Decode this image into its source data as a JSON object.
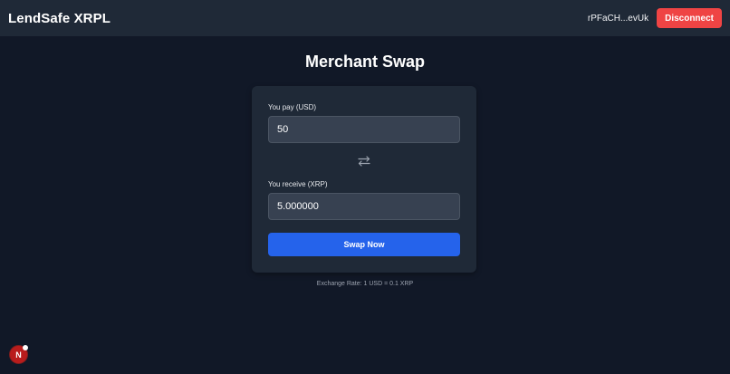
{
  "header": {
    "brand": "LendSafe XRPL",
    "wallet_address": "rPFaCH...evUk",
    "disconnect_label": "Disconnect"
  },
  "main": {
    "title": "Merchant Swap",
    "pay": {
      "label": "You pay (USD)",
      "value": "50"
    },
    "receive": {
      "label": "You receive (XRP)",
      "value": "5.000000"
    },
    "swap_icon": "swap-arrows-icon",
    "swap_button_label": "Swap Now",
    "exchange_rate": "Exchange Rate: 1 USD = 0.1 XRP"
  },
  "floating": {
    "badge_letter": "N"
  },
  "colors": {
    "background": "#111827",
    "surface": "#1f2937",
    "input": "#374151",
    "accent": "#2563eb",
    "danger": "#ef4444"
  }
}
